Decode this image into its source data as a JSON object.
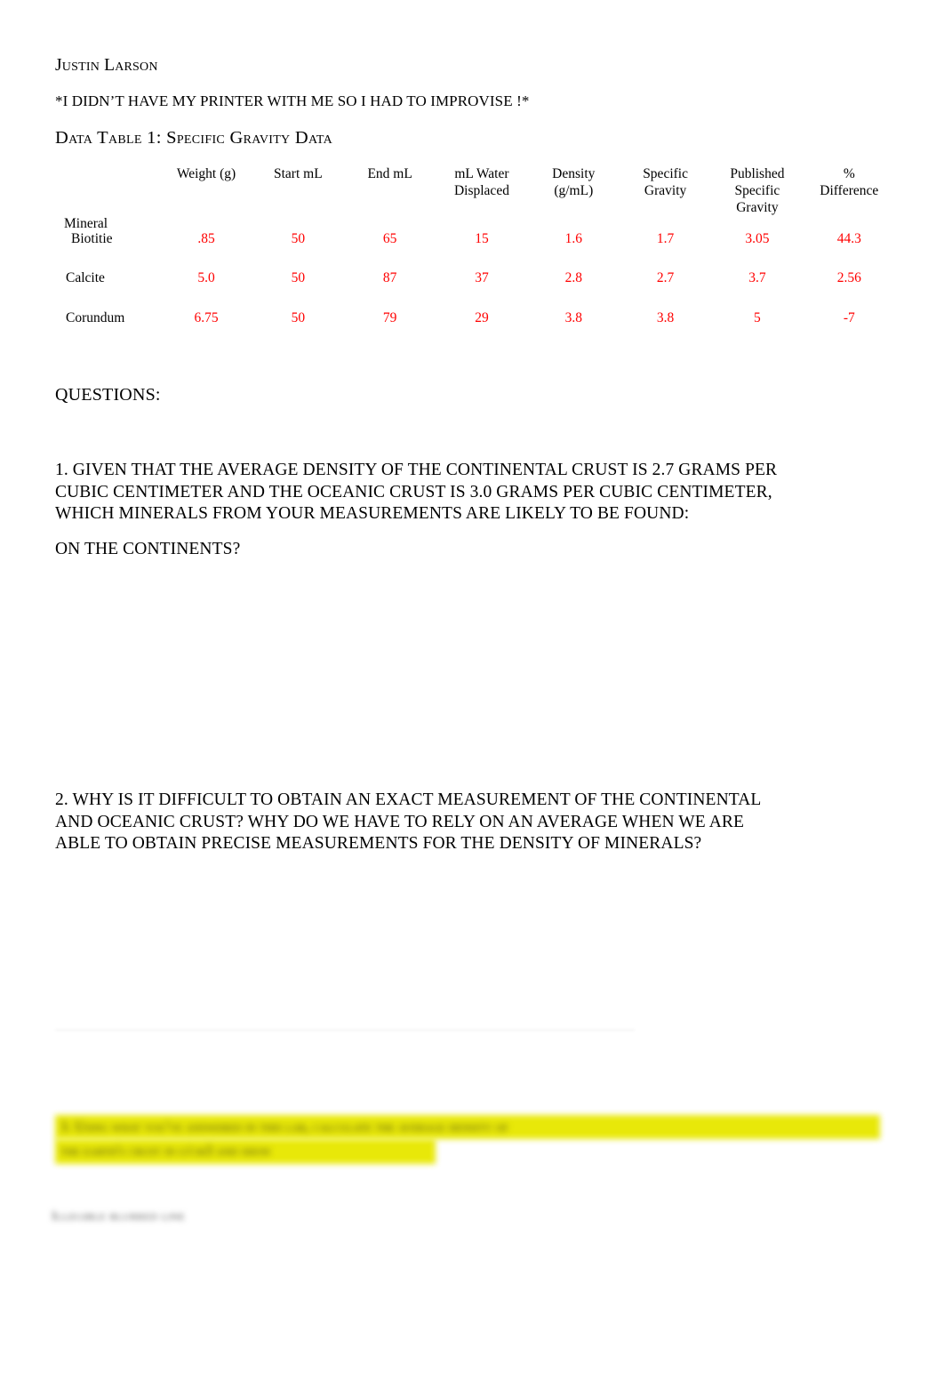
{
  "document": {
    "author": "Justin Larson",
    "note": "*I DIDN’T HAVE MY PRINTER WITH ME SO I HAD TO IMPROVISE   !*",
    "table_title": "Data Table 1:  Specific Gravity Data"
  },
  "table": {
    "corner_header": "",
    "row_group_label": "Mineral",
    "columns": [
      "Weight (g)",
      "Start mL",
      "End mL",
      "mL Water Displaced",
      "Density (g/mL)",
      "Specific Gravity",
      "Published Specific Gravity",
      "% Difference"
    ],
    "columns_wrapped": [
      [
        "Weight (g)"
      ],
      [
        "Start mL"
      ],
      [
        "End mL"
      ],
      [
        "mL Water",
        "Displaced"
      ],
      [
        "Density",
        "(g/mL)"
      ],
      [
        "Specific",
        "Gravity"
      ],
      [
        "Published",
        "Specific",
        "Gravity"
      ],
      [
        "%",
        "Difference"
      ]
    ],
    "value_color": "#ff0000",
    "rows": [
      {
        "mineral": "Biotitie",
        "weight_g": ".85",
        "start_ml": "50",
        "end_ml": "65",
        "ml_water_displaced": "15",
        "density_g_ml": "1.6",
        "specific_gravity": "1.7",
        "published_specific_gravity": "3.05",
        "percent_difference": "44.3"
      },
      {
        "mineral": "Calcite",
        "weight_g": "5.0",
        "start_ml": "50",
        "end_ml": "87",
        "ml_water_displaced": "37",
        "density_g_ml": "2.8",
        "specific_gravity": "2.7",
        "published_specific_gravity": "3.7",
        "percent_difference": "2.56"
      },
      {
        "mineral": "Corundum",
        "weight_g": "6.75",
        "start_ml": "50",
        "end_ml": "79",
        "ml_water_displaced": "29",
        "density_g_ml": "3.8",
        "specific_gravity": "3.8",
        "published_specific_gravity": "5",
        "percent_difference": "-7"
      }
    ]
  },
  "questions": {
    "heading": "QUESTIONS:",
    "q1": "1.  GIVEN THAT  THE  AVERAGE   DENSITY OF THE CONTINENTAL  CRUST  IS 2.7  GRAMS  PER\nCUBIC  CENTIMETER  AND THE OCEANIC  CRUST  IS 3.0 GRAMS  PER  CUBIC  CENTIMETER,\nWHICH MINERALS  FROM  YOUR MEASUREMENTS   ARE LIKELY  TO BE FOUND:",
    "q1_sub": "ON THE CONTINENTS?",
    "q2": "2.  WHY IS IT DIFFICULT  TO OBTAIN  AN EXACT MEASUREMENT  OF  THE CONTINENTAL\nAND OCEANIC CRUST?    WHY DO WE HAVE  TO RELY  ON  AN AVERAGE   WHEN WE ARE\nABLE TO OBTAIN  PRECISE   MEASUREMENTS   FOR  THE DENSITY  OF  MINERALS?"
  },
  "obscured": {
    "highlight_color": "#e8e800",
    "highlight_text": "3. Using what you've answered in this lab, calculate the average density of\nthe earth's crust in g/cm3 and show",
    "bottom_text": "Illegible blurred line"
  }
}
